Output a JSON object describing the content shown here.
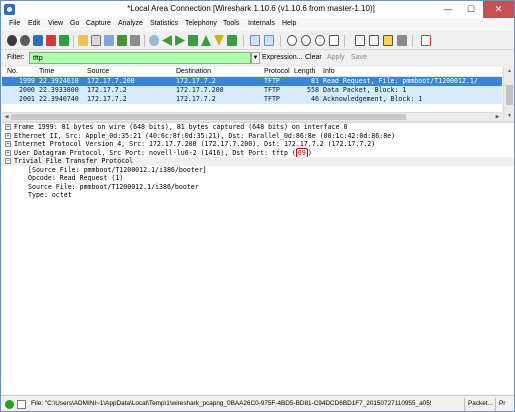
{
  "window": {
    "title": "*Local Area Connection   [Wireshark 1.10.6  (v1.10.6 from master-1.10)]",
    "controls": {
      "minimize": "—",
      "maximize": "☐",
      "close": "✕"
    }
  },
  "menu": [
    "File",
    "Edit",
    "View",
    "Go",
    "Capture",
    "Analyze",
    "Statistics",
    "Telephony",
    "Tools",
    "Internals",
    "Help"
  ],
  "toolbar": {
    "icons": [
      "interfaces-icon",
      "capture-options-icon",
      "start-capture-icon",
      "stop-capture-icon",
      "restart-capture-icon",
      "open-file-icon",
      "save-file-icon",
      "close-file-icon",
      "reload-icon",
      "print-icon",
      "find-packet-icon",
      "go-back-icon",
      "go-forward-icon",
      "go-to-packet-icon",
      "go-first-icon",
      "go-last-icon",
      "colorize-icon",
      "auto-scroll-icon",
      "zoom-in-icon",
      "zoom-out-icon",
      "zoom-normal-icon",
      "resize-columns-icon",
      "capture-filters-icon",
      "display-filters-icon",
      "coloring-rules-icon",
      "preferences-icon",
      "help-icon"
    ]
  },
  "filter": {
    "label": "Filter:",
    "value": "tftp",
    "expression_label": "Expression...",
    "clear_label": "Clear",
    "apply_label": "Apply",
    "save_label": "Save",
    "accent": "#afffaf"
  },
  "packet_list": {
    "columns": [
      "No.",
      "Time",
      "Source",
      "Destination",
      "Protocol",
      "Length",
      "Info"
    ],
    "rows": [
      {
        "no": "1999",
        "time": "22.3924610",
        "source": "172.17.7.200",
        "destination": "172.17.7.2",
        "protocol": "TFTP",
        "length": "81",
        "info": "Read Request, File: pmmboot/T1200012.1/",
        "selected": true
      },
      {
        "no": "2000",
        "time": "22.3933800",
        "source": "172.17.7.2",
        "destination": "172.17.7.200",
        "protocol": "TFTP",
        "length": "558",
        "info": "Data Packet, Block: 1",
        "selected": false
      },
      {
        "no": "2001",
        "time": "22.3940740",
        "source": "172.17.7.2",
        "destination": "172.17.7.2",
        "protocol": "TFTP",
        "length": "46",
        "info": "Acknowledgement, Block: 1",
        "selected": false
      }
    ],
    "selected_color": "#3b84d6",
    "row_color": "#d7ecfa"
  },
  "details": {
    "lines": [
      {
        "text": "Frame 1999: 81 bytes on wire (648 bits), 81 bytes captured (648 bits) on interface 0",
        "expander": "+"
      },
      {
        "text": "Ethernet II, Src: Apple_0d:35:21 (40:6c:8f:0d:35:21), Dst: Parallel_0d:86:8e (00:1c:42:0d:86:8e)",
        "expander": "+"
      },
      {
        "text": "Internet Protocol Version 4, Src: 172.17.7.200 (172.17.7.200), Dst: 172.17.7.2 (172.17.7.2)",
        "expander": "+"
      },
      {
        "text_prefix": "User Datagram Protocol, Src Port: novell-lu6-2 (1416), Dst Port: tftp (",
        "text_highlight": "69",
        "text_suffix": ")",
        "expander": "+"
      },
      {
        "text": "Trivial File Transfer Protocol",
        "expander": "−"
      }
    ],
    "children": [
      "[Source File: pmmboot/T1200012.1/i386/booter]",
      "Opcode: Read Request (1)",
      "Source File: pmmboot/T1200012.1/i386/booter",
      "Type: octet"
    ]
  },
  "status": {
    "file_text": "File: \"C:\\Users\\ADMINI~1\\AppData\\Local\\Temp\\1\\wireshark_pcapng_0BAA26C0-975F-4BD5-BD81-C94DCD6BD1F7_20150727110955_a05992\"...",
    "packets_text": "Packet...",
    "profile_text": "Pr"
  }
}
